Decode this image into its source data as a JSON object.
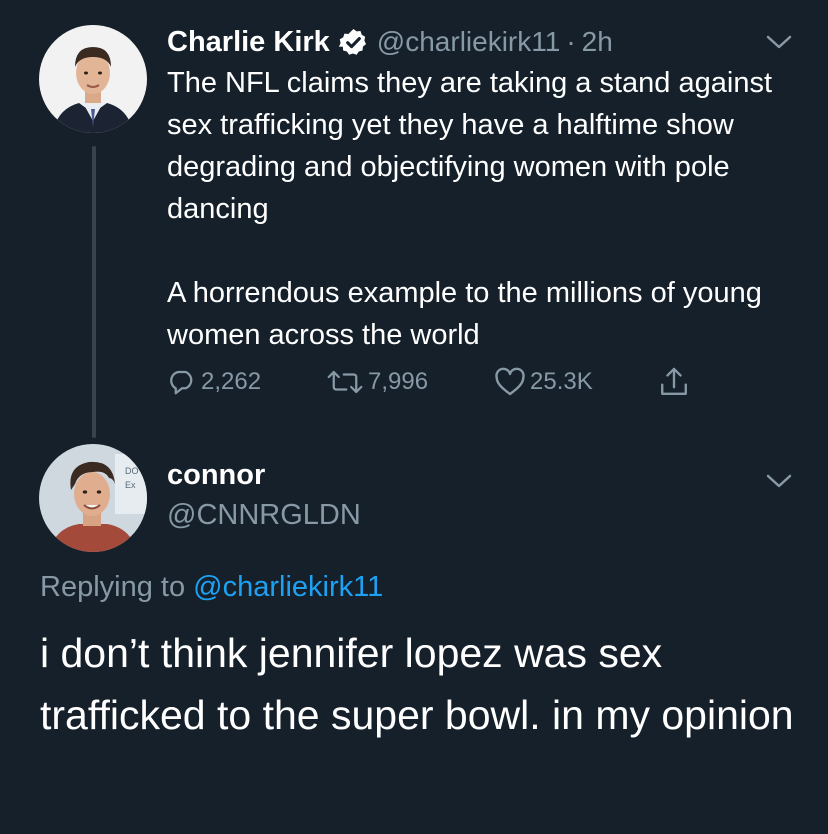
{
  "colors": {
    "background": "#15202b",
    "primary_text": "#ffffff",
    "secondary_text": "#8899a6",
    "link": "#1da1f2",
    "thread_line": "#38444d"
  },
  "tweet": {
    "author": {
      "display_name": "Charlie Kirk",
      "verified_icon": "verified-badge-icon",
      "handle": "@charliekirk11",
      "separator": "·",
      "time": "2h"
    },
    "text": "The NFL claims they are taking a stand against sex trafficking yet they have a halftime show degrading and objectifying women with pole dancing\n\nA horrendous example to the millions of young women across the world",
    "actions": {
      "replies": "2,262",
      "retweets": "7,996",
      "likes": "25.3K"
    },
    "icons": {
      "reply": "reply-icon",
      "retweet": "retweet-icon",
      "like": "heart-icon",
      "share": "share-icon",
      "more": "chevron-down-icon"
    }
  },
  "reply": {
    "author": {
      "display_name": "connor",
      "handle": "@CNNRGLDN"
    },
    "replying_label": "Replying to",
    "replying_to": "@charliekirk11",
    "text": "i don’t think jennifer lopez was sex trafficked to the super bowl. in my opinion"
  }
}
